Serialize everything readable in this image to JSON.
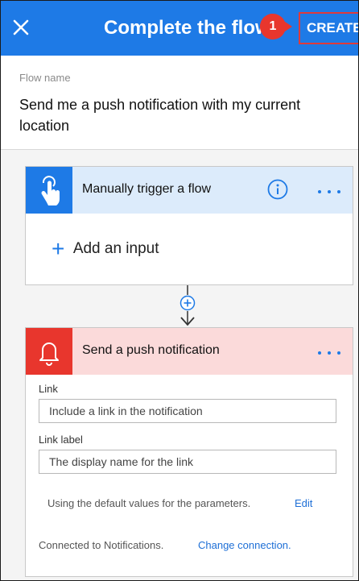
{
  "header": {
    "title": "Complete the flow",
    "create_label": "CREATE",
    "step_number": "1",
    "colors": {
      "bar": "#1e7ae6",
      "highlight": "#e03a3a"
    }
  },
  "flow_name": {
    "label": "Flow name",
    "value": "Send me a push notification with my current location"
  },
  "trigger": {
    "title": "Manually trigger a flow",
    "icon": "hand-tap-icon",
    "add_input_label": "Add an input"
  },
  "action": {
    "title": "Send a push notification",
    "icon": "bell-icon",
    "fields": [
      {
        "label": "Link",
        "placeholder": "Include a link in the notification"
      },
      {
        "label": "Link label",
        "placeholder": "The display name for the link"
      }
    ],
    "default_note": "Using the default values for the parameters.",
    "edit_label": "Edit",
    "connected_note": "Connected to Notifications.",
    "change_connection_label": "Change connection."
  }
}
